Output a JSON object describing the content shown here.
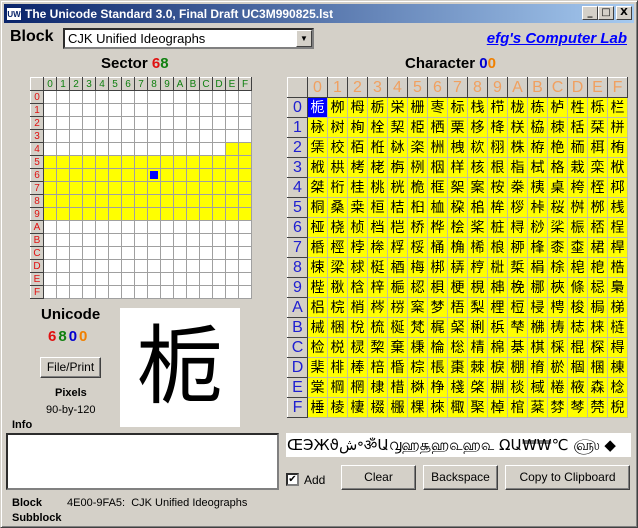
{
  "window": {
    "title": "The Unicode Standard 3.0, Final Draft UC3M990825.lst",
    "app_icon_text": "UW",
    "minimize_icon": "minimize-icon",
    "maximize_icon": "maximize-icon",
    "close_icon": "close-icon",
    "minimize_glyph": "_",
    "maximize_glyph": "□",
    "close_glyph": "X"
  },
  "header": {
    "block_label": "Block",
    "block_selected": "CJK Unified Ideographs",
    "dropdown_arrow": "▼",
    "link_text": "efg's Computer Lab"
  },
  "sector": {
    "label": "Sector",
    "hi_digit": "6",
    "lo_digit": "8",
    "hex_labels": [
      "0",
      "1",
      "2",
      "3",
      "4",
      "5",
      "6",
      "7",
      "8",
      "9",
      "A",
      "B",
      "C",
      "D",
      "E",
      "F"
    ],
    "block_range_start": "4E",
    "block_range_end": "9F",
    "current": "68"
  },
  "character": {
    "label": "Character",
    "hi_digit": "0",
    "lo_digit": "0",
    "base_codepoint": "6800",
    "selected_index": 0
  },
  "unicode": {
    "label": "Unicode",
    "digits": [
      "6",
      "8",
      "0",
      "0"
    ],
    "digit_colors": [
      "#e01010",
      "#108010",
      "#0000d0",
      "#f08000"
    ]
  },
  "file_print_button": "File/Print",
  "pixels": {
    "label": "Pixels",
    "value": "90-by-120"
  },
  "preview_glyph": "栀",
  "info": {
    "label": "Info",
    "text": ""
  },
  "status": {
    "block_label": "Block",
    "block_value": "4E00-9FA5:  CJK Unified Ideographs",
    "subblock_label": "Subblock",
    "subblock_value": ""
  },
  "sample_text": "ŒЭЖϑش॰ॐԱ൮ஹ௲ஹ௳ஹ௳ ΩԱ₩₩℃ ௵ ◆",
  "add_checkbox": {
    "label": "Add",
    "checked": true,
    "check_glyph": "✔"
  },
  "buttons": {
    "clear": "Clear",
    "backspace": "Backspace",
    "copy": "Copy to Clipboard"
  }
}
